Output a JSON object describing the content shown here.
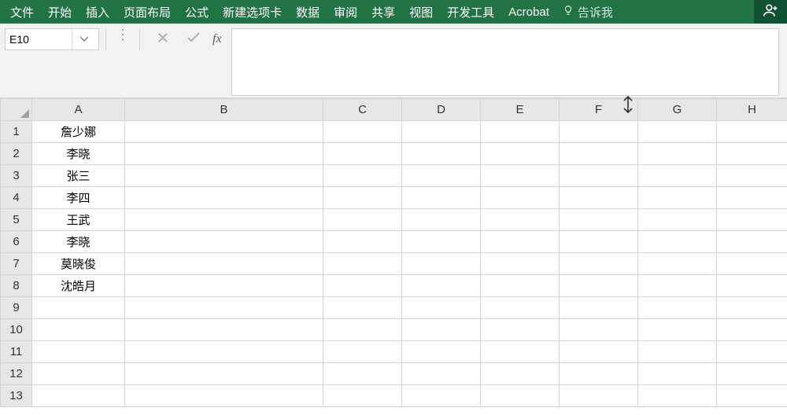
{
  "ribbon": {
    "tabs": [
      "文件",
      "开始",
      "插入",
      "页面布局",
      "公式",
      "新建选项卡",
      "数据",
      "审阅",
      "共享",
      "视图",
      "开发工具",
      "Acrobat"
    ],
    "tell_me": "告诉我"
  },
  "formula_bar": {
    "name_box_value": "E10",
    "fx_label": "fx",
    "formula_value": ""
  },
  "sheet": {
    "columns": [
      "A",
      "B",
      "C",
      "D",
      "E",
      "F",
      "G",
      "H"
    ],
    "row_count": 13,
    "cells": {
      "A1": "詹少娜",
      "A2": "李晓",
      "A3": "张三",
      "A4": "李四",
      "A5": "王武",
      "A6": "李晓",
      "A7": "莫晓俊",
      "A8": "沈皓月"
    }
  }
}
